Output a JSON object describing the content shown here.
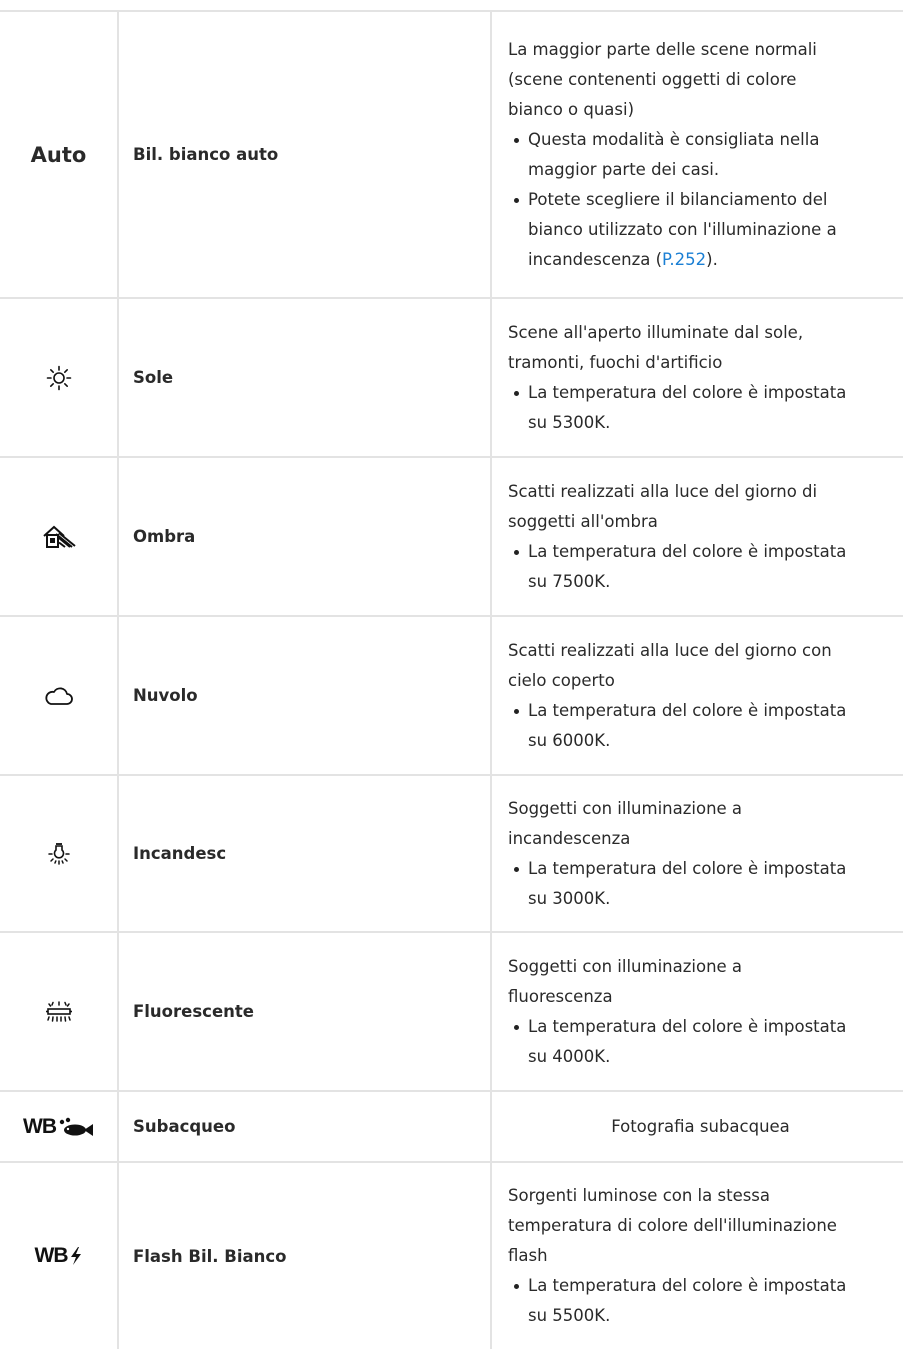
{
  "rows": [
    {
      "icon": "auto-text",
      "icon_text": "Auto",
      "name": "Bil. bianco auto",
      "desc_lines": [
        "La maggior parte delle scene normali",
        "(scene contenenti oggetti di colore",
        "bianco o quasi)"
      ],
      "bullet1_lines": [
        "Questa modalità è consigliata nella",
        "maggior parte dei casi."
      ],
      "bullet2_lines": [
        "Potete scegliere il bilanciamento del",
        "bianco utilizzato con l'illuminazione a"
      ],
      "bullet2_last_prefix": "incandescenza (",
      "bullet2_link": "P.252",
      "bullet2_last_suffix": ")."
    },
    {
      "icon": "sun-icon",
      "name": "Sole",
      "desc_lines": [
        "Scene all'aperto illuminate dal sole,",
        "tramonti, fuochi d'artificio"
      ],
      "bullet_lines": [
        "La temperatura del colore è impostata",
        "su 5300K."
      ]
    },
    {
      "icon": "shade-icon",
      "name": "Ombra",
      "desc_lines": [
        "Scatti realizzati alla luce del giorno di",
        "soggetti all'ombra"
      ],
      "bullet_lines": [
        "La temperatura del colore è impostata",
        "su 7500K."
      ]
    },
    {
      "icon": "cloud-icon",
      "name": "Nuvolo",
      "desc_lines": [
        "Scatti realizzati alla luce del giorno con",
        "cielo coperto"
      ],
      "bullet_lines": [
        "La temperatura del colore è impostata",
        "su 6000K."
      ]
    },
    {
      "icon": "incandescent-bulb-icon",
      "name": "Incandesc",
      "desc_lines": [
        "Soggetti con illuminazione a",
        "incandescenza"
      ],
      "bullet_lines": [
        "La temperatura del colore è impostata",
        "su 3000K."
      ]
    },
    {
      "icon": "fluorescent-lamp-icon",
      "name": "Fluorescente",
      "desc_lines": [
        "Soggetti con illuminazione a",
        "fluorescenza"
      ],
      "bullet_lines": [
        "La temperatura del colore è impostata",
        "su 4000K."
      ]
    },
    {
      "icon": "wb-underwater-icon",
      "icon_text": "WB",
      "name": "Subacqueo",
      "desc_lines": [
        "Fotografia subacquea"
      ]
    },
    {
      "icon": "wb-flash-icon",
      "icon_text": "WB",
      "name": "Flash Bil. Bianco",
      "desc_lines": [
        "Sorgenti luminose con la stessa",
        "temperatura di colore dell'illuminazione",
        "flash"
      ],
      "bullet_lines": [
        "La temperatura del colore è impostata",
        "su 5500K."
      ]
    }
  ],
  "colors": {
    "border": "#e3e3e3",
    "link": "#1a7fd4",
    "text": "#2a2a2a"
  }
}
